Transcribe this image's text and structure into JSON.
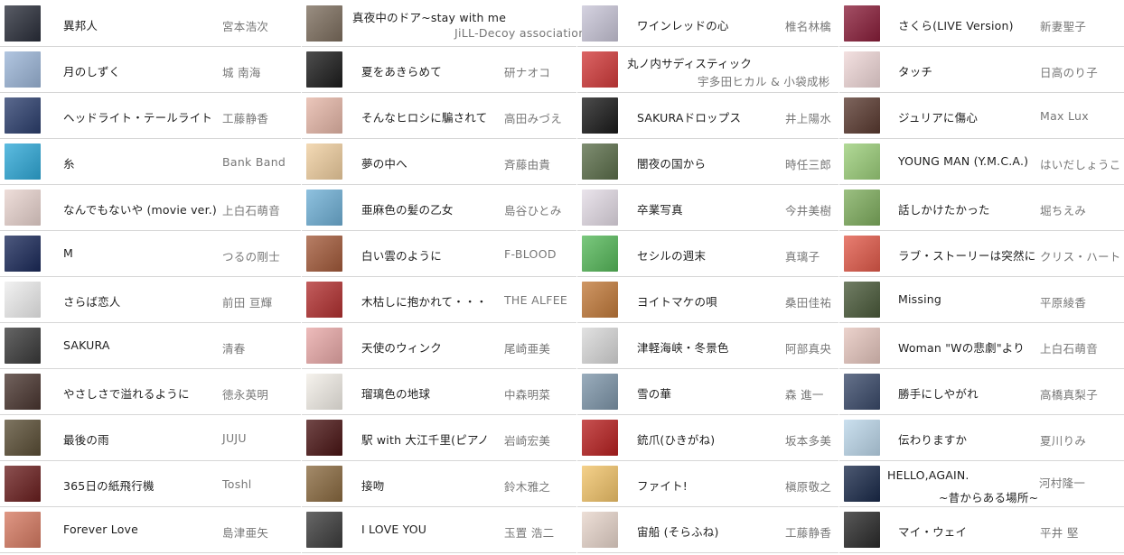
{
  "columns": [
    {
      "songs": [
        {
          "title": "異邦人",
          "artist": "宮本浩次",
          "art": "#2a2e3a"
        },
        {
          "title": "月のしずく",
          "artist": "城 南海",
          "art": "#9cb6d8"
        },
        {
          "title": "ヘッドライト・テールライト",
          "artist": "工藤静香",
          "art": "#2c3f6e"
        },
        {
          "title": "糸",
          "artist": "Bank Band",
          "art": "#2fa9d8"
        },
        {
          "title": "なんでもないや (movie ver.)",
          "artist": "上白石萌音",
          "art": "#e9d4cf"
        },
        {
          "title": "M",
          "artist": "つるの剛士",
          "art": "#1b2a5a"
        },
        {
          "title": "さらば恋人",
          "artist": "前田 亘輝",
          "art": "#eeeeee"
        },
        {
          "title": "SAKURA",
          "artist": "清春",
          "art": "#3a3a3a"
        },
        {
          "title": "やさしさで溢れるように",
          "artist": "徳永英明",
          "art": "#4a3630"
        },
        {
          "title": "最後の雨",
          "artist": "JUJU",
          "art": "#5a4e35"
        },
        {
          "title": "365日の紙飛行機",
          "artist": "Toshl",
          "art": "#6b1f1f"
        },
        {
          "title": "Forever Love",
          "artist": "島津亜矢",
          "art": "#d67a62"
        }
      ]
    },
    {
      "songs": [
        {
          "title": "真夜中のドア~stay with me",
          "artist": "JiLL-Decoy association",
          "art": "#7d6e5e"
        },
        {
          "title": "夏をあきらめて",
          "artist": "研ナオコ",
          "art": "#1c1c1c"
        },
        {
          "title": "そんなヒロシに騙されて",
          "artist": "高田みづえ",
          "art": "#e6b7a8"
        },
        {
          "title": "夢の中へ",
          "artist": "斉藤由貴",
          "art": "#f0cfa0"
        },
        {
          "title": "亜麻色の髪の乙女",
          "artist": "島谷ひとみ",
          "art": "#6fb0d6"
        },
        {
          "title": "白い雲のように",
          "artist": "F-BLOOD",
          "art": "#a35a3a"
        },
        {
          "title": "木枯しに抱かれて・・・",
          "artist": "THE ALFEE",
          "art": "#b23030"
        },
        {
          "title": "天使のウィンク",
          "artist": "尾崎亜美",
          "art": "#e9a9a8"
        },
        {
          "title": "瑠璃色の地球",
          "artist": "中森明菜",
          "art": "#f3efe8"
        },
        {
          "title": "駅 with 大江千里(ピアノ",
          "artist": "岩崎宏美",
          "art": "#4a1414"
        },
        {
          "title": "接吻",
          "artist": "鈴木雅之",
          "art": "#8a6a40"
        },
        {
          "title": "I LOVE YOU",
          "artist": "玉置 浩二",
          "art": "#3c3c3c"
        }
      ]
    },
    {
      "songs": [
        {
          "title": "ワインレッドの心",
          "artist": "椎名林檎",
          "art": "#c9c6d8"
        },
        {
          "title": "丸ノ内サディスティック",
          "artist": "宇多田ヒカル & 小袋成彬",
          "art": "#d23a3a"
        },
        {
          "title": "SAKURAドロップス",
          "artist": "井上陽水",
          "art": "#1a1a1a"
        },
        {
          "title": "闇夜の国から",
          "artist": "時任三郎",
          "art": "#5b6e4a"
        },
        {
          "title": "卒業写真",
          "artist": "今井美樹",
          "art": "#e4dce6"
        },
        {
          "title": "セシルの週末",
          "artist": "真璃子",
          "art": "#56b95a"
        },
        {
          "title": "ヨイトマケの唄",
          "artist": "桑田佳祐",
          "art": "#c27a3a"
        },
        {
          "title": "津軽海峡・冬景色",
          "artist": "阿部真央",
          "art": "#d9d9d9"
        },
        {
          "title": "雪の華",
          "artist": "森 進一",
          "art": "#7e96aa"
        },
        {
          "title": "銃爪(ひきがね)",
          "artist": "坂本多美",
          "art": "#b82020"
        },
        {
          "title": "ファイト!",
          "artist": "槇原敬之",
          "art": "#f2c46a"
        },
        {
          "title": "宙船 (そらふね)",
          "artist": "工藤静香",
          "art": "#e8d6cc"
        }
      ]
    },
    {
      "songs": [
        {
          "title": "さくら(LIVE Version)",
          "artist": "新妻聖子",
          "art": "#8a1e3a"
        },
        {
          "title": "タッチ",
          "artist": "日高のり子",
          "art": "#f0d8d8"
        },
        {
          "title": "ジュリアに傷心",
          "artist": "Max Lux",
          "art": "#5a3a30"
        },
        {
          "title": "YOUNG MAN (Y.M.C.A.)",
          "artist": "はいだしょうこ",
          "art": "#9ccf7a"
        },
        {
          "title": "話しかけたかった",
          "artist": "堀ちえみ",
          "art": "#7fae5e"
        },
        {
          "title": "ラブ・ストーリーは突然に",
          "artist": "クリス・ハート",
          "art": "#e25a4a"
        },
        {
          "title": "Missing",
          "artist": "平原綾香",
          "art": "#4a5a3a"
        },
        {
          "title": "Woman \"Wの悲劇\"より",
          "artist": "上白石萌音",
          "art": "#e6c6be"
        },
        {
          "title": "勝手にしやがれ",
          "artist": "高橋真梨子",
          "art": "#3a4a6a"
        },
        {
          "title": "伝わりますか",
          "artist": "夏川りみ",
          "art": "#bcd7ea"
        },
        {
          "title": "HELLO,AGAIN.",
          "subtitle": "~昔からある場所~",
          "artist": "河村隆一",
          "art": "#1a2a4a"
        },
        {
          "title": "マイ・ウェイ",
          "artist": "平井 堅",
          "art": "#2a2a2a"
        }
      ]
    }
  ]
}
